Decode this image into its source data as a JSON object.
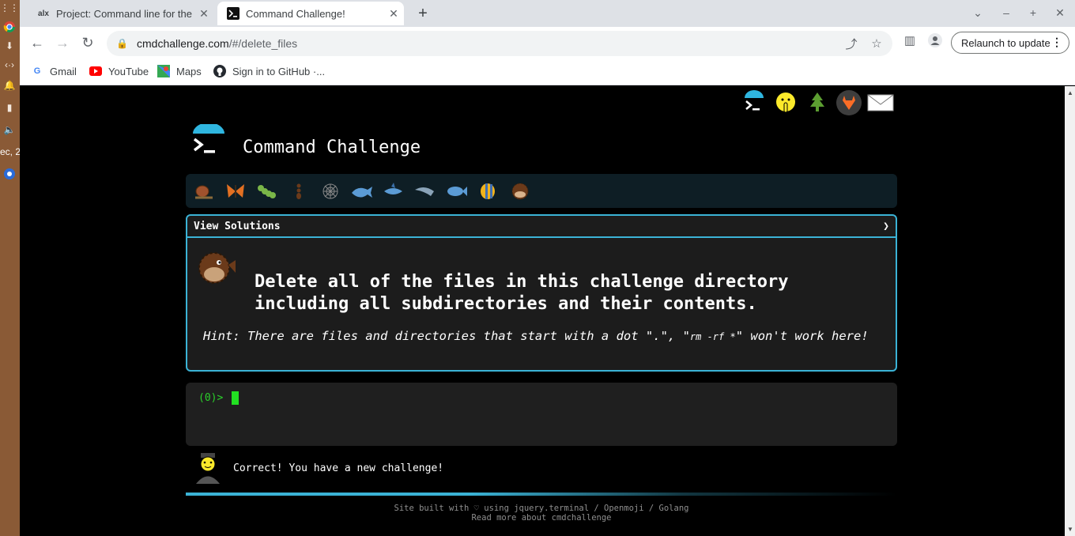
{
  "desktop": {
    "clock_fragment": "ec, 2"
  },
  "browser": {
    "tabs": [
      {
        "label": "Project: Command line for the",
        "favicon": "alx"
      },
      {
        "label": "Command Challenge!",
        "favicon": "terminal-icon"
      }
    ],
    "url_domain": "cmdchallenge.com",
    "url_path": "/#/delete_files",
    "relaunch_label": "Relaunch to update",
    "bookmarks": [
      {
        "label": "Gmail",
        "icon": "google-icon"
      },
      {
        "label": "YouTube",
        "icon": "youtube-icon"
      },
      {
        "label": "Maps",
        "icon": "maps-icon"
      },
      {
        "label": "Sign in to GitHub ·...",
        "icon": "github-icon"
      }
    ]
  },
  "page": {
    "site_title": "Command Challenge",
    "solutions_label": "View Solutions",
    "solutions_chevron": "❯",
    "challenge_line1": "Delete all of the files in this challenge directory",
    "challenge_line2": "including all subdirectories and their contents.",
    "hint_prefix": "Hint: There are files and directories that start with a dot \".\", \"",
    "hint_code": "rm -rf *",
    "hint_suffix": "\" won't work here!",
    "prompt": "(0)>",
    "status_message": "Correct! You have a new challenge!",
    "footer_line1": "Site built with ♡ using jquery.terminal / Openmoji / Golang",
    "footer_line2": "Read more about cmdchallenge",
    "progress_fraction": 0.5
  },
  "emoji_bar": [
    "snail-icon",
    "butterfly-icon",
    "caterpillar-icon",
    "ant-icon",
    "spider-web-icon",
    "whale-icon",
    "shark-icon",
    "dolphin-icon",
    "fish-icon",
    "tropical-fish-icon",
    "pufferfish-icon"
  ],
  "top_icons": [
    "cmdchallenge-icon",
    "shushing-face-icon",
    "tree-icon",
    "gitlab-icon",
    "envelope-icon"
  ]
}
